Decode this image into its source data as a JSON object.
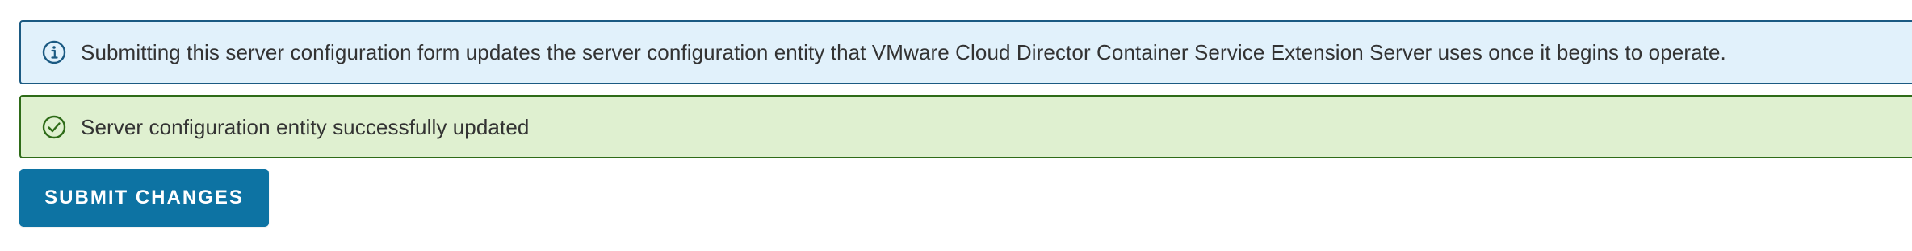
{
  "alerts": {
    "info": {
      "icon": "info-circle-icon",
      "message": "Submitting this server configuration form updates the server configuration entity that VMware Cloud Director Container Service Extension Server uses once it begins to operate.",
      "colors": {
        "background": "#e1f1fb",
        "border": "#1b5a82",
        "icon": "#1b5a82"
      }
    },
    "success": {
      "icon": "check-circle-icon",
      "message": "Server configuration entity successfully updated",
      "colors": {
        "background": "#dff0d0",
        "border": "#2e6b18",
        "icon": "#2e6b18"
      }
    }
  },
  "actions": {
    "submit_label": "SUBMIT CHANGES",
    "submit_color": "#0d73a3"
  }
}
